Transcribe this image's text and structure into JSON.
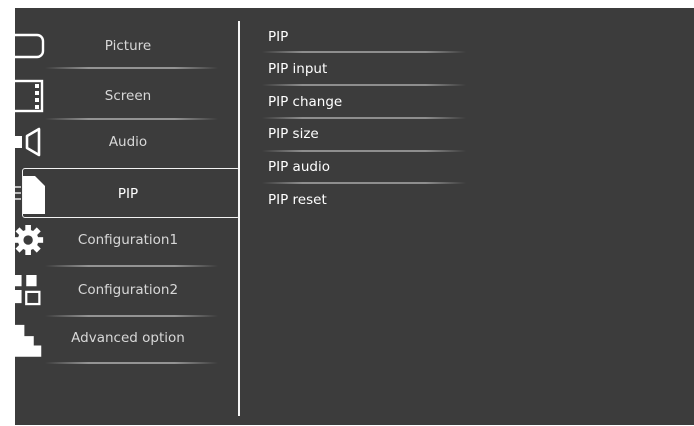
{
  "left_menu": {
    "items": [
      {
        "label": "Picture",
        "icon": "picture-icon"
      },
      {
        "label": "Screen",
        "icon": "screen-icon"
      },
      {
        "label": "Audio",
        "icon": "audio-icon"
      },
      {
        "label": "PIP",
        "icon": "pip-icon",
        "selected": true
      },
      {
        "label": "Configuration1",
        "icon": "gear-icon"
      },
      {
        "label": "Configuration2",
        "icon": "config2-icon"
      },
      {
        "label": "Advanced option",
        "icon": "advanced-icon"
      }
    ]
  },
  "right_menu": {
    "items": [
      {
        "label": "PIP"
      },
      {
        "label": "PIP input"
      },
      {
        "label": "PIP change"
      },
      {
        "label": "PIP size"
      },
      {
        "label": "PIP audio"
      },
      {
        "label": "PIP reset"
      }
    ]
  },
  "colors": {
    "background": "#3c3c3c",
    "text_left": "#d8d8d8",
    "text_right": "#ffffff",
    "highlight_border": "#f2f2f2"
  }
}
